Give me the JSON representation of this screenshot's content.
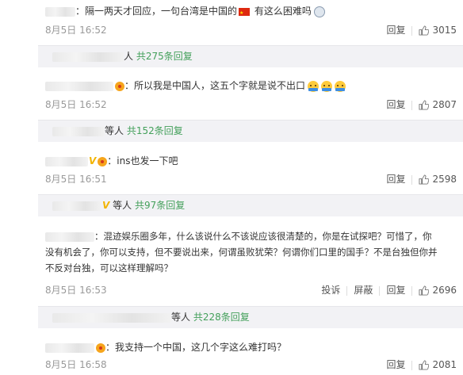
{
  "comments": [
    {
      "text": "：隔一两天才回应，一句台湾是中国的",
      "text_after_flag": " 有这么困难吗",
      "time": "8月5日 16:52",
      "reply_label": "回复",
      "likes": "3015",
      "reply_summary": {
        "suffix": "人",
        "count_label": "共275条回复"
      }
    },
    {
      "text": "：所以我是中国人，这五个字就是说不出口",
      "time": "8月5日 16:52",
      "reply_label": "回复",
      "likes": "2807",
      "reply_summary": {
        "suffix": "等人",
        "count_label": "共152条回复"
      }
    },
    {
      "text": "：ins也发一下吧",
      "time": "8月5日 16:51",
      "reply_label": "回复",
      "likes": "2598",
      "reply_summary": {
        "suffix": "等人",
        "count_label": "共97条回复"
      }
    },
    {
      "text_line1": "：混迹娱乐圈多年，什么该说什么不该说应该很清楚的，你是在试探吧？可惜了，你",
      "text_line2": "没有机会了，你可以支持，但不要说出来，何谓虽败犹荣？何谓你们口里的国手？不是台独但你并",
      "text_line3": "不反对台独，可以这样理解吗？",
      "time": "8月5日 16:53",
      "report_label": "投诉",
      "block_label": "屏蔽",
      "reply_label": "回复",
      "likes": "2696",
      "reply_summary": {
        "suffix": "等人",
        "count_label": "共228条回复"
      }
    },
    {
      "text": "：我支持一个中国，这几个字这么难打吗？",
      "time": "8月5日 16:58",
      "reply_label": "回复",
      "likes": "2081"
    }
  ],
  "colors": {
    "link_green": "#44a05b",
    "meta_gray": "#999999",
    "reply_bg": "#f2f2f5"
  },
  "icons": [
    "thumbs-up-icon",
    "user-badge-icon",
    "emoji-icon",
    "flag-icon"
  ]
}
